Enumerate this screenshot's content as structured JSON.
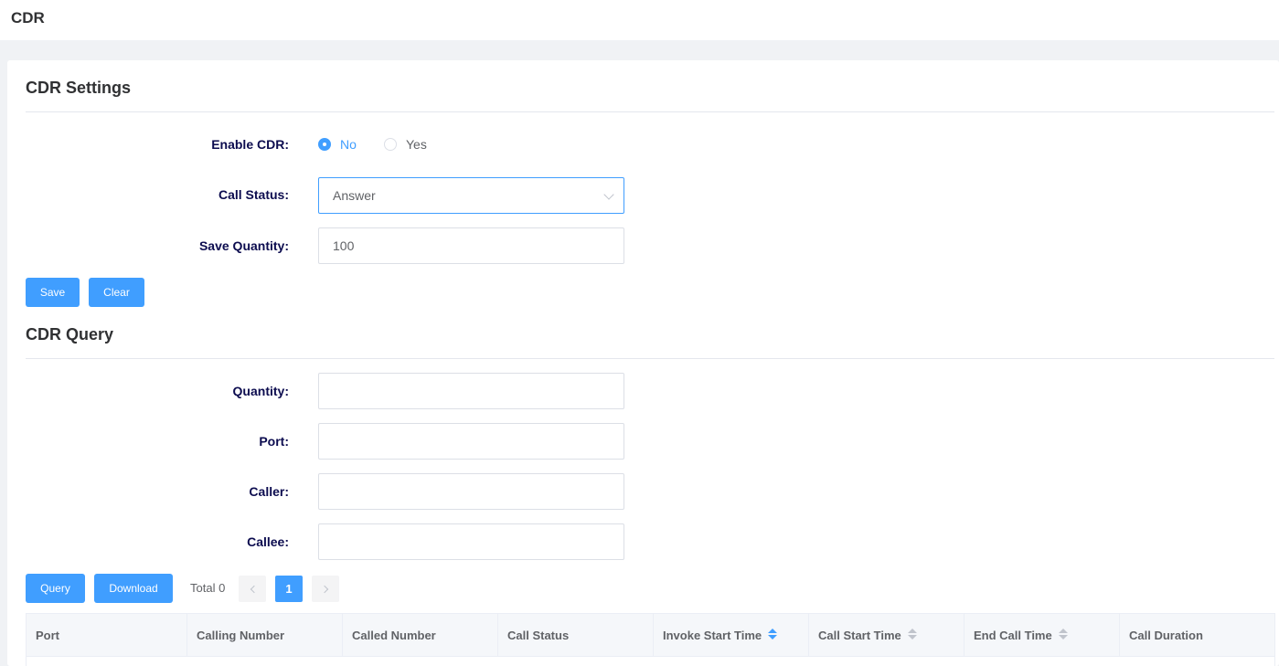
{
  "page": {
    "title": "CDR"
  },
  "settings": {
    "title": "CDR Settings",
    "enable_label": "Enable CDR:",
    "enable_options": [
      "No",
      "Yes"
    ],
    "enable_selected": "No",
    "call_status_label": "Call Status:",
    "call_status_value": "Answer",
    "save_quantity_label": "Save Quantity:",
    "save_quantity_value": "100",
    "save_button": "Save",
    "clear_button": "Clear"
  },
  "query": {
    "title": "CDR Query",
    "quantity_label": "Quantity:",
    "quantity_value": "",
    "port_label": "Port:",
    "port_value": "",
    "caller_label": "Caller:",
    "caller_value": "",
    "callee_label": "Callee:",
    "callee_value": "",
    "query_button": "Query",
    "download_button": "Download",
    "total_text": "Total 0",
    "current_page": "1"
  },
  "table": {
    "columns": [
      {
        "label": "Port",
        "sortable": false
      },
      {
        "label": "Calling Number",
        "sortable": false
      },
      {
        "label": "Called Number",
        "sortable": false
      },
      {
        "label": "Call Status",
        "sortable": false
      },
      {
        "label": "Invoke Start Time",
        "sortable": true,
        "active": true
      },
      {
        "label": "Call Start Time",
        "sortable": true
      },
      {
        "label": "End Call Time",
        "sortable": true
      },
      {
        "label": "Call Duration",
        "sortable": false
      }
    ]
  },
  "colors": {
    "accent": "#409eff",
    "label": "#0c0c4f"
  },
  "icons": [
    "radio-icon",
    "chevron-down-icon",
    "chevron-left-icon",
    "chevron-right-icon",
    "sort-icon"
  ]
}
